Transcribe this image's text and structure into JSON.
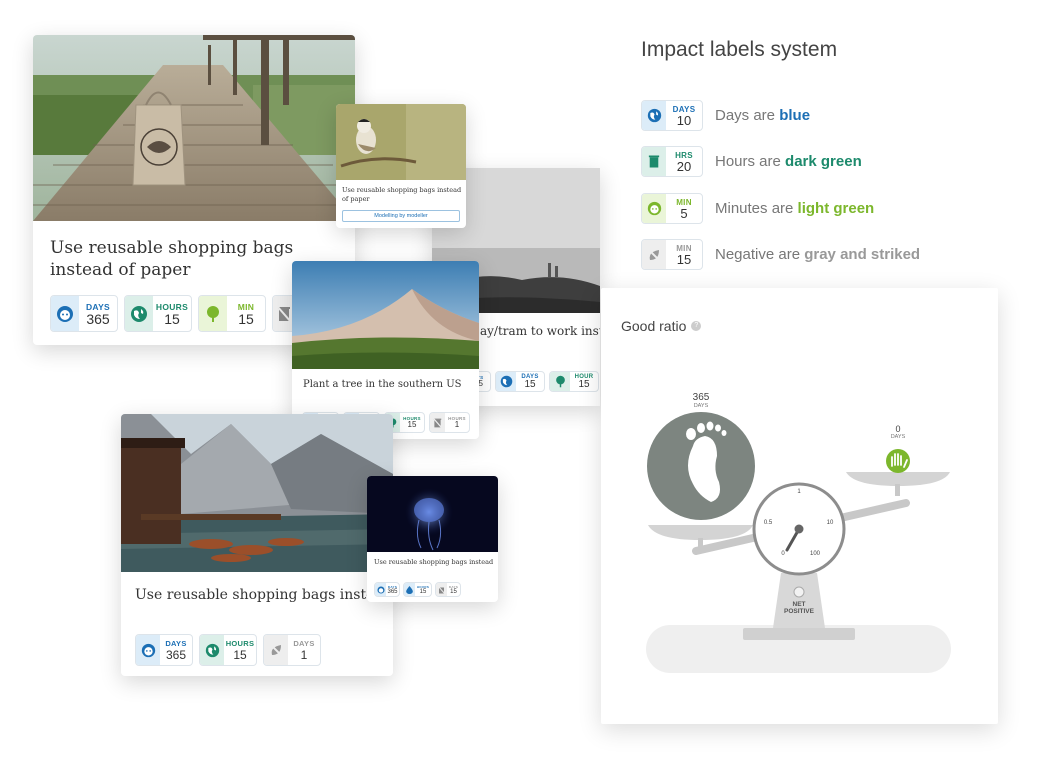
{
  "colors": {
    "blue": "#1c6fb5",
    "dark_green": "#1d8a6c",
    "light_green": "#7cb72c",
    "gray": "#999999"
  },
  "card_main": {
    "title": "Use reusable shopping bags instead of paper",
    "labels": [
      {
        "unit": "DAYS",
        "value": "365",
        "icon": "face-icon",
        "kind": "blue"
      },
      {
        "unit": "HOURS",
        "value": "15",
        "icon": "globe-icon",
        "kind": "dark-green"
      },
      {
        "unit": "MIN",
        "value": "15",
        "icon": "tree-icon",
        "kind": "light-green"
      },
      {
        "icon": "trash-strike-icon",
        "kind": "gray"
      }
    ]
  },
  "card_bird": {
    "title": "Use reusable shopping bags instead of paper",
    "button": "Modelling by modeller"
  },
  "card_fog": {
    "title": "ay/tram to work inste",
    "labels": [
      {
        "unit": "AYS",
        "value": "65",
        "kind": "blue"
      },
      {
        "unit": "DAYS",
        "value": "15",
        "icon": "globe-icon",
        "kind": "blue"
      },
      {
        "unit": "HOUR",
        "value": "15",
        "icon": "tree-icon",
        "kind": "dark-green"
      }
    ]
  },
  "card_dune": {
    "title": "Plant a tree in the southern US",
    "labels": [
      {
        "unit": "DAYS",
        "value": "365",
        "icon": "drop-icon",
        "kind": "blue"
      },
      {
        "unit": "DAYS",
        "value": "15",
        "icon": "globe-icon",
        "kind": "blue"
      },
      {
        "unit": "HOURS",
        "value": "15",
        "icon": "tree-icon",
        "kind": "dark-green"
      },
      {
        "unit": "HOURS",
        "value": "1",
        "icon": "trash-strike-icon",
        "kind": "gray"
      }
    ]
  },
  "card_lake": {
    "title": "Use reusable shopping bags instead",
    "labels": [
      {
        "unit": "DAYS",
        "value": "365",
        "icon": "face-icon",
        "kind": "blue"
      },
      {
        "unit": "HOURS",
        "value": "15",
        "icon": "globe-icon",
        "kind": "dark-green"
      },
      {
        "unit": "DAYS",
        "value": "1",
        "icon": "leaf-strike-icon",
        "kind": "gray"
      }
    ]
  },
  "card_jelly": {
    "title": "Use reusable shopping bags instead",
    "labels": [
      {
        "unit": "DAYS",
        "value": "365",
        "kind": "blue"
      },
      {
        "unit": "HOURS",
        "value": "15",
        "kind": "blue"
      },
      {
        "unit": "DAYS",
        "value": "15",
        "kind": "gray"
      }
    ]
  },
  "legend": {
    "heading": "Impact labels system",
    "rows": [
      {
        "unit": "DAYS",
        "value": "10",
        "icon": "globe-icon",
        "kind": "blue",
        "text": "Days are ",
        "strong": "blue"
      },
      {
        "unit": "HRS",
        "value": "20",
        "icon": "trash-icon",
        "kind": "dark-green",
        "text": "Hours are ",
        "strong": "dark green"
      },
      {
        "unit": "MIN",
        "value": "5",
        "icon": "face-icon",
        "kind": "light-green",
        "text": "Minutes are ",
        "strong": "light green"
      },
      {
        "unit": "MIN",
        "value": "15",
        "icon": "leaf-strike-icon",
        "kind": "gray",
        "text": "Negative are ",
        "strong": "gray and striked"
      }
    ]
  },
  "ratio": {
    "title": "Good ratio",
    "left_value": "365",
    "left_unit": "DAYS",
    "right_value": "0",
    "right_unit": "DAYS",
    "gauge": {
      "top": "1",
      "left": "0.5",
      "right": "10",
      "bottom_left": "0",
      "bottom_right": "100"
    },
    "status": "NET\nPOSITIVE"
  }
}
